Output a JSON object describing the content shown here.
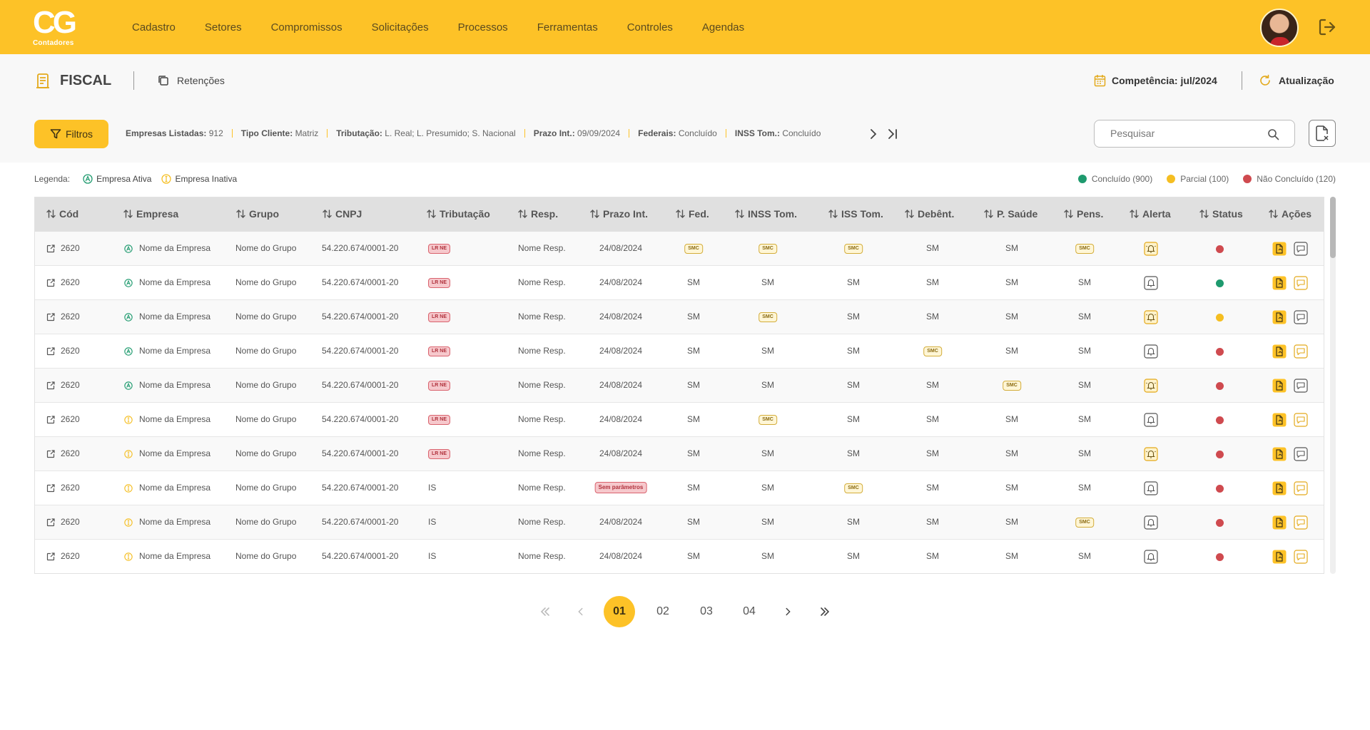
{
  "brand": {
    "logo_text": "CG",
    "logo_sub": "Contadores"
  },
  "nav": [
    "Cadastro",
    "Setores",
    "Compromissos",
    "Solicitações",
    "Processos",
    "Ferramentas",
    "Controles",
    "Agendas"
  ],
  "page": {
    "title": "FISCAL",
    "tab": "Retenções",
    "competencia": "Competência: jul/2024",
    "atualizacao": "Atualização"
  },
  "filters": {
    "button": "Filtros",
    "summary": [
      {
        "label": "Empresas Listadas:",
        "value": "912"
      },
      {
        "label": "Tipo Cliente:",
        "value": "Matriz"
      },
      {
        "label": "Tributação:",
        "value": "L. Real; L. Presumido; S. Nacional"
      },
      {
        "label": "Prazo Int.:",
        "value": "09/09/2024"
      },
      {
        "label": "Federais:",
        "value": "Concluído"
      },
      {
        "label": "INSS Tom.:",
        "value": "Concluído"
      }
    ]
  },
  "search": {
    "placeholder": "Pesquisar"
  },
  "legend": {
    "label": "Legenda:",
    "active": "Empresa Ativa",
    "inactive": "Empresa Inativa"
  },
  "status_legend": [
    {
      "label": "Concluído (900)",
      "color": "#1E9A6E"
    },
    {
      "label": "Parcial (100)",
      "color": "#F5BE21"
    },
    {
      "label": "Não Concluído (120)",
      "color": "#CF4A4F"
    }
  ],
  "colors": {
    "accent": "#FDC227",
    "green": "#1E9A6E",
    "yellow": "#F5BE21",
    "red": "#CF4A4F"
  },
  "columns": [
    "Cód",
    "Empresa",
    "Grupo",
    "CNPJ",
    "Tributação",
    "Resp.",
    "Prazo Int.",
    "Fed.",
    "INSS Tom.",
    "ISS Tom.",
    "Debênt.",
    "P. Saúde",
    "Pens.",
    "Alerta",
    "Status",
    "Ações"
  ],
  "rows": [
    {
      "cod": "2620",
      "active": true,
      "empresa": "Nome da Empresa",
      "grupo": "Nome do Grupo",
      "cnpj": "54.220.674/0001-20",
      "trib": "LR NE",
      "trib_badge": true,
      "resp": "Nome Resp.",
      "prazo": "24/08/2024",
      "prazo_badge": false,
      "fed": "SMC",
      "inss": "SMC",
      "iss": "SMC",
      "deb": "SM",
      "saude": "SM",
      "pens": "SMC",
      "alert_ring": true,
      "status": "red",
      "chat_yellow": false
    },
    {
      "cod": "2620",
      "active": true,
      "empresa": "Nome da Empresa",
      "grupo": "Nome do Grupo",
      "cnpj": "54.220.674/0001-20",
      "trib": "LR NE",
      "trib_badge": true,
      "resp": "Nome Resp.",
      "prazo": "24/08/2024",
      "prazo_badge": false,
      "fed": "SM",
      "inss": "SM",
      "iss": "SM",
      "deb": "SM",
      "saude": "SM",
      "pens": "SM",
      "alert_ring": false,
      "status": "green",
      "chat_yellow": true
    },
    {
      "cod": "2620",
      "active": true,
      "empresa": "Nome da Empresa",
      "grupo": "Nome do Grupo",
      "cnpj": "54.220.674/0001-20",
      "trib": "LR NE",
      "trib_badge": true,
      "resp": "Nome Resp.",
      "prazo": "24/08/2024",
      "prazo_badge": false,
      "fed": "SM",
      "inss": "SMC",
      "iss": "SM",
      "deb": "SM",
      "saude": "SM",
      "pens": "SM",
      "alert_ring": true,
      "status": "yellow",
      "chat_yellow": false
    },
    {
      "cod": "2620",
      "active": true,
      "empresa": "Nome da Empresa",
      "grupo": "Nome do Grupo",
      "cnpj": "54.220.674/0001-20",
      "trib": "LR NE",
      "trib_badge": true,
      "resp": "Nome Resp.",
      "prazo": "24/08/2024",
      "prazo_badge": false,
      "fed": "SM",
      "inss": "SM",
      "iss": "SM",
      "deb": "SMC",
      "saude": "SM",
      "pens": "SM",
      "alert_ring": false,
      "status": "red",
      "chat_yellow": true
    },
    {
      "cod": "2620",
      "active": true,
      "empresa": "Nome da Empresa",
      "grupo": "Nome do Grupo",
      "cnpj": "54.220.674/0001-20",
      "trib": "LR NE",
      "trib_badge": true,
      "resp": "Nome Resp.",
      "prazo": "24/08/2024",
      "prazo_badge": false,
      "fed": "SM",
      "inss": "SM",
      "iss": "SM",
      "deb": "SM",
      "saude": "SMC",
      "pens": "SM",
      "alert_ring": true,
      "status": "red",
      "chat_yellow": false
    },
    {
      "cod": "2620",
      "active": false,
      "empresa": "Nome da Empresa",
      "grupo": "Nome do Grupo",
      "cnpj": "54.220.674/0001-20",
      "trib": "LR NE",
      "trib_badge": true,
      "resp": "Nome Resp.",
      "prazo": "24/08/2024",
      "prazo_badge": false,
      "fed": "SM",
      "inss": "SMC",
      "iss": "SM",
      "deb": "SM",
      "saude": "SM",
      "pens": "SM",
      "alert_ring": false,
      "status": "red",
      "chat_yellow": true
    },
    {
      "cod": "2620",
      "active": false,
      "empresa": "Nome da Empresa",
      "grupo": "Nome do Grupo",
      "cnpj": "54.220.674/0001-20",
      "trib": "LR NE",
      "trib_badge": true,
      "resp": "Nome Resp.",
      "prazo": "24/08/2024",
      "prazo_badge": false,
      "fed": "SM",
      "inss": "SM",
      "iss": "SM",
      "deb": "SM",
      "saude": "SM",
      "pens": "SM",
      "alert_ring": true,
      "status": "red",
      "chat_yellow": false
    },
    {
      "cod": "2620",
      "active": false,
      "empresa": "Nome da Empresa",
      "grupo": "Nome do Grupo",
      "cnpj": "54.220.674/0001-20",
      "trib": "IS",
      "trib_badge": false,
      "resp": "Nome Resp.",
      "prazo": "Sem parâmetros",
      "prazo_badge": true,
      "fed": "SM",
      "inss": "SM",
      "iss": "SMC",
      "deb": "SM",
      "saude": "SM",
      "pens": "SM",
      "alert_ring": false,
      "status": "red",
      "chat_yellow": true
    },
    {
      "cod": "2620",
      "active": false,
      "empresa": "Nome da Empresa",
      "grupo": "Nome do Grupo",
      "cnpj": "54.220.674/0001-20",
      "trib": "IS",
      "trib_badge": false,
      "resp": "Nome Resp.",
      "prazo": "24/08/2024",
      "prazo_badge": false,
      "fed": "SM",
      "inss": "SM",
      "iss": "SM",
      "deb": "SM",
      "saude": "SM",
      "pens": "SMC",
      "alert_ring": false,
      "status": "red",
      "chat_yellow": true
    },
    {
      "cod": "2620",
      "active": false,
      "empresa": "Nome da Empresa",
      "grupo": "Nome do Grupo",
      "cnpj": "54.220.674/0001-20",
      "trib": "IS",
      "trib_badge": false,
      "resp": "Nome Resp.",
      "prazo": "24/08/2024",
      "prazo_badge": false,
      "fed": "SM",
      "inss": "SM",
      "iss": "SM",
      "deb": "SM",
      "saude": "SM",
      "pens": "SM",
      "alert_ring": false,
      "status": "red",
      "chat_yellow": true
    }
  ],
  "pagination": {
    "pages": [
      "01",
      "02",
      "03",
      "04"
    ],
    "current": "01"
  }
}
